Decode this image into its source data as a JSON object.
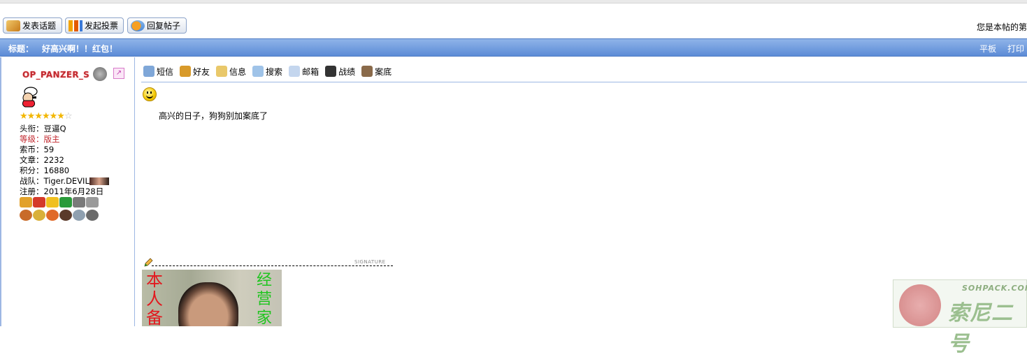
{
  "toolbar": {
    "new_topic": "发表话题",
    "new_poll": "发起投票",
    "reply": "回复帖子",
    "right_text": "您是本帖的第"
  },
  "titlebar": {
    "label": "标题：",
    "title": "好高兴啊！！红包！",
    "links": [
      "平板",
      "打印"
    ]
  },
  "author": {
    "username": "OP_PANZER_S",
    "stars_filled": 6,
    "stars_total": 7,
    "fields": [
      {
        "label": "头衔：",
        "value": "豆逼Q"
      },
      {
        "label": "等级：",
        "value": "版主"
      },
      {
        "label": "索币：",
        "value": "59"
      },
      {
        "label": "文章：",
        "value": "2232"
      },
      {
        "label": "积分：",
        "value": "16880"
      },
      {
        "label": "战队：",
        "value": "Tiger.DEVIL"
      },
      {
        "label": "注册：",
        "value": "2011年6月28日"
      }
    ],
    "medal_colors": [
      "#e2a12a",
      "#d43a2a",
      "#f0c020",
      "#2a9a3a",
      "#7a7a7a",
      "#9a9a9a",
      "#c86b2a",
      "#d9b03a",
      "#e06a2a",
      "#5a3a2a",
      "#8fa0b0",
      "#6a6a6a"
    ]
  },
  "post_actions": [
    "短信",
    "好友",
    "信息",
    "搜索",
    "邮箱",
    "战绩",
    "案底"
  ],
  "post": {
    "content": "高兴的日子，狗狗别加案底了"
  },
  "signature": {
    "label": "SIGNATURE",
    "left_text": "本人备",
    "right_text": "经营家"
  },
  "watermark": {
    "url": "SOHPACK.COM",
    "name": "索尼二号"
  }
}
